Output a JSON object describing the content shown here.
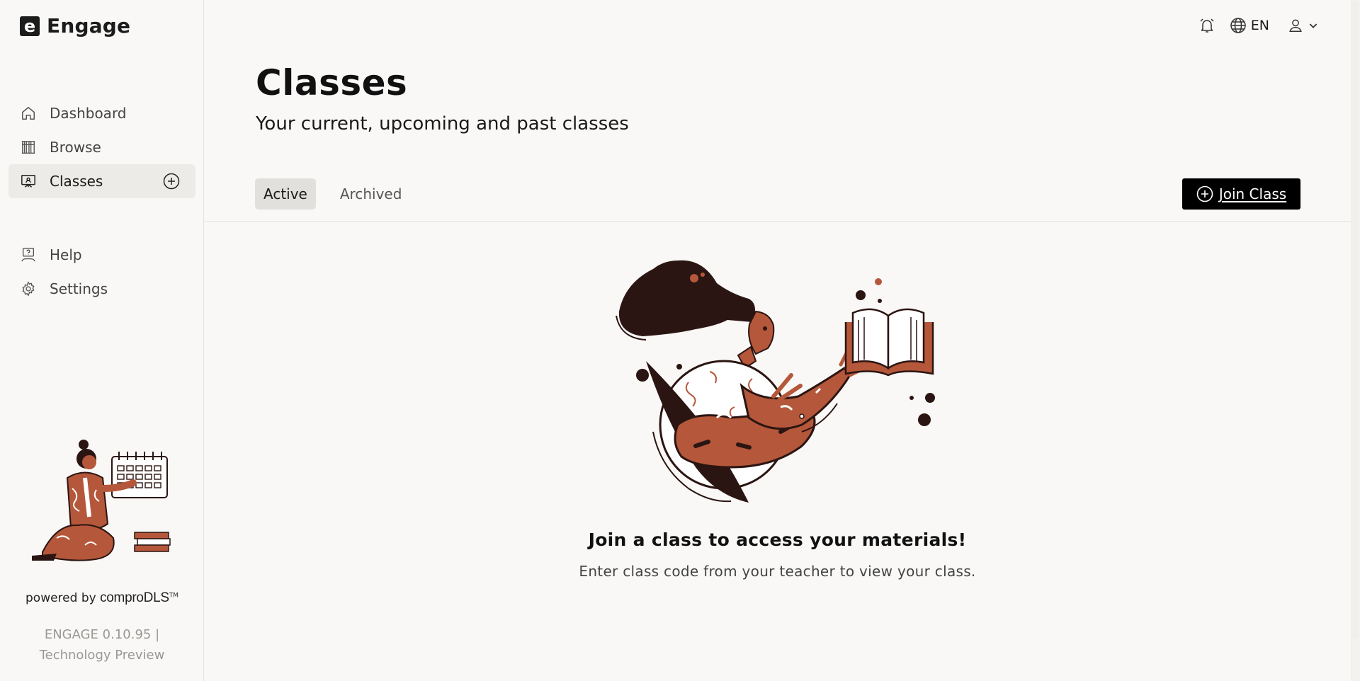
{
  "app": {
    "name": "Engage",
    "logo_letter": "e"
  },
  "sidebar": {
    "items": [
      {
        "label": "Dashboard",
        "icon": "home-icon"
      },
      {
        "label": "Browse",
        "icon": "library-icon"
      },
      {
        "label": "Classes",
        "icon": "classroom-icon",
        "active": true
      },
      {
        "label": "Help",
        "icon": "help-icon"
      },
      {
        "label": "Settings",
        "icon": "gear-icon"
      }
    ],
    "powered_by": "powered by",
    "powered_brand": "comproDLS",
    "powered_tm": "TM",
    "version_line1": "ENGAGE 0.10.95 |",
    "version_line2": "Technology Preview"
  },
  "topbar": {
    "language": "EN",
    "icons": [
      "alarm-bell-icon",
      "globe-icon",
      "user-icon",
      "chevron-down-icon"
    ]
  },
  "main": {
    "title": "Classes",
    "subtitle": "Your current, upcoming and past classes",
    "tabs": [
      {
        "label": "Active",
        "active": true
      },
      {
        "label": "Archived",
        "active": false
      }
    ],
    "join_button": "Join Class",
    "empty_title": "Join a class to access your materials!",
    "empty_text": "Enter class code from your teacher to view your class."
  },
  "colors": {
    "accent": "#000000",
    "illustration_brown": "#b5573a",
    "illustration_dark": "#2b1512",
    "background": "#f9f8f6"
  }
}
